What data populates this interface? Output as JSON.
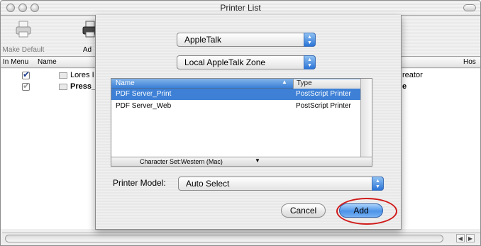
{
  "window": {
    "title": "Printer List"
  },
  "toolbar": {
    "make_default_label": "Make Default",
    "add_label": "Ad"
  },
  "list": {
    "columns": {
      "in_menu": "In Menu",
      "name": "Name",
      "kind": "reator",
      "host": "Hos"
    },
    "rows": [
      {
        "name": "Lores I",
        "checked": true,
        "bold": false
      },
      {
        "name": "Press_",
        "checked": true,
        "bold": true,
        "extra": "e"
      }
    ]
  },
  "dialog": {
    "connection_popup": "AppleTalk",
    "zone_popup": "Local AppleTalk Zone",
    "browser": {
      "headers": {
        "name": "Name",
        "type": "Type"
      },
      "rows": [
        {
          "name": "PDF Server_Print",
          "type": "PostScript Printer",
          "selected": true
        },
        {
          "name": "PDF Server_Web",
          "type": "PostScript Printer",
          "selected": false
        }
      ],
      "character_set": "Character Set:Western (Mac)"
    },
    "printer_model_label": "Printer Model:",
    "printer_model_value": "Auto Select",
    "cancel_label": "Cancel",
    "add_label": "Add"
  },
  "colors": {
    "selection": "#3d80d6",
    "default_button": "#4d93e8",
    "annotation": "#d11a1a"
  }
}
